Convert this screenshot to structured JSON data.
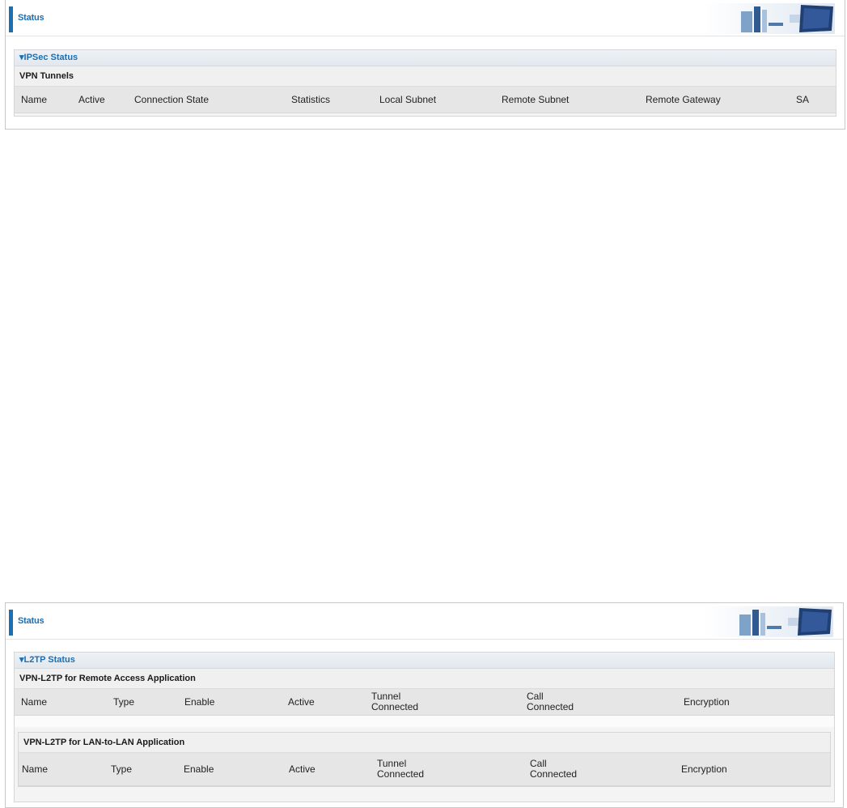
{
  "ipsec_page": {
    "header": {
      "title": "Status"
    },
    "section": {
      "title": "▾IPSec Status",
      "subheading": "VPN Tunnels",
      "columns": [
        "Name",
        "Active",
        "Connection State",
        "Statistics",
        "Local Subnet",
        "Remote Subnet",
        "Remote Gateway",
        "SA"
      ]
    }
  },
  "l2tp_page": {
    "header": {
      "title": "Status"
    },
    "section": {
      "title": "▾L2TP Status",
      "remote_access": {
        "subheading": "VPN-L2TP for Remote Access Application",
        "columns": [
          "Name",
          "Type",
          "Enable",
          "Active",
          "Tunnel\nConnected",
          "Call\nConnected",
          "Encryption"
        ]
      },
      "lan_to_lan": {
        "subheading": "VPN-L2TP for LAN-to-LAN Application",
        "columns": [
          "Name",
          "Type",
          "Enable",
          "Active",
          "Tunnel\nConnected",
          "Call\nConnected",
          "Encryption"
        ]
      }
    }
  },
  "colors": {
    "accent": "#1b6fb4",
    "header_bg": "#e6e6e6"
  },
  "icons": {
    "banner": "network-banner-icon"
  }
}
